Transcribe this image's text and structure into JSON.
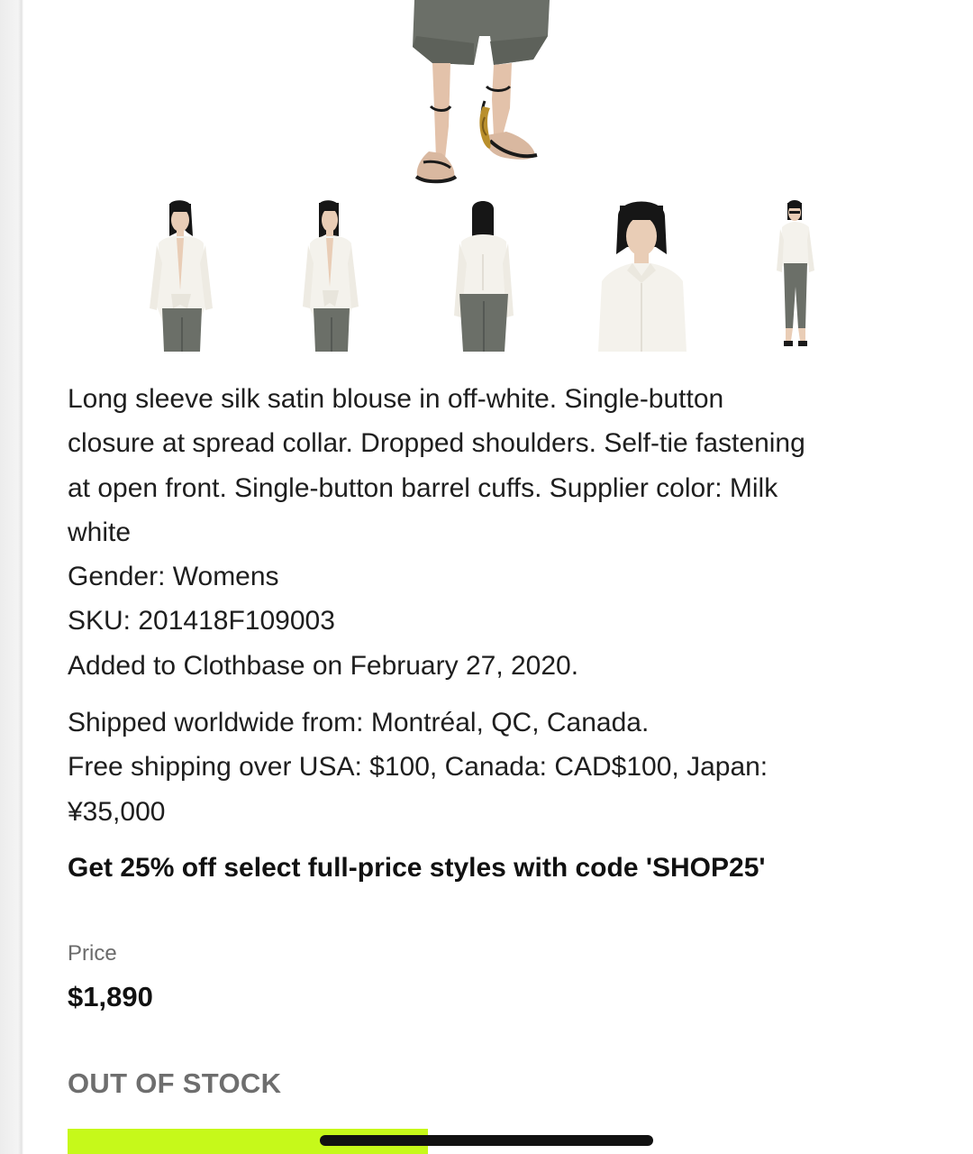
{
  "product": {
    "description": [
      "Long sleeve silk satin blouse in off-white. Single-button",
      "closure at spread collar. Dropped shoulders. Self-tie fastening",
      "at open front. Single-button barrel cuffs. Supplier color: Milk",
      "white"
    ],
    "gender": "Gender: Womens",
    "sku": "SKU: 201418F109003",
    "added": "Added to Clothbase on February 27, 2020."
  },
  "shipping": {
    "origin": "Shipped worldwide from: Montréal, QC, Canada.",
    "free_line_1": "Free shipping over USA: $100, Canada: CAD$100, Japan:",
    "free_line_2": "¥35,000"
  },
  "promo": {
    "text": "Get 25% off select full-price styles with code 'SHOP25'"
  },
  "pricing": {
    "label": "Price",
    "value": "$1,890"
  },
  "stock": {
    "status": "OUT OF STOCK"
  },
  "gallery": {
    "thumbnails": [
      "front-view",
      "three-quarter-view",
      "back-view",
      "close-up-view",
      "full-length-view"
    ]
  },
  "colors": {
    "accent": "#c6f91a",
    "blouse": "#f4f2ec",
    "trousers": "#6b6f68",
    "hair": "#161616",
    "skin": "#e9cdb6"
  }
}
